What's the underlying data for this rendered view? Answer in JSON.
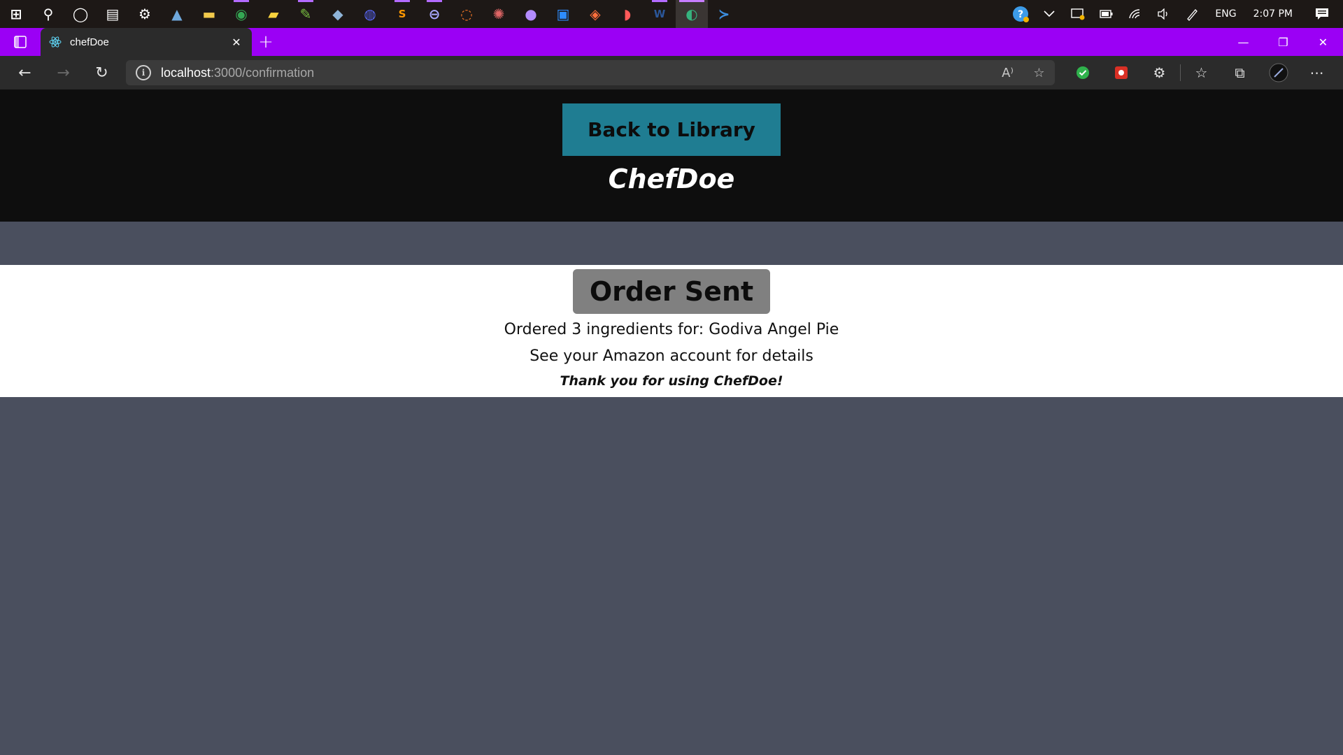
{
  "taskbar": {
    "icons": [
      {
        "name": "windows-start-icon",
        "glyph": "⊞",
        "color": "#ffffff"
      },
      {
        "name": "search-icon",
        "glyph": "⚲",
        "color": "#ffffff"
      },
      {
        "name": "cortana-icon",
        "glyph": "◯",
        "color": "#ffffff"
      },
      {
        "name": "task-view-icon",
        "glyph": "▤",
        "color": "#ffffff"
      },
      {
        "name": "settings-icon",
        "glyph": "⚙",
        "color": "#ffffff"
      },
      {
        "name": "photos-icon",
        "glyph": "▲",
        "color": "#6fa8dc"
      },
      {
        "name": "file-explorer-icon",
        "glyph": "▬",
        "color": "#f2c94c"
      },
      {
        "name": "chrome-icon",
        "glyph": "◉",
        "color": "#34a853"
      },
      {
        "name": "sticky-notes-icon",
        "glyph": "▰",
        "color": "#f7d23e"
      },
      {
        "name": "notepad-icon",
        "glyph": "✎",
        "color": "#7ac142"
      },
      {
        "name": "app-icon",
        "glyph": "◆",
        "color": "#8fb4d8"
      },
      {
        "name": "discord-icon",
        "glyph": "◍",
        "color": "#5865f2"
      },
      {
        "name": "sublime-text-icon",
        "glyph": "S",
        "color": "#ff9800"
      },
      {
        "name": "app-icon-2",
        "glyph": "⊖",
        "color": "#a9a9ff"
      },
      {
        "name": "jupyter-icon",
        "glyph": "◌",
        "color": "#f37626"
      },
      {
        "name": "network-app-icon",
        "glyph": "✺",
        "color": "#e06666"
      },
      {
        "name": "github-icon",
        "glyph": "●",
        "color": "#b48cff"
      },
      {
        "name": "zoom-icon",
        "glyph": "▣",
        "color": "#2d8cff"
      },
      {
        "name": "firefox-icon",
        "glyph": "◈",
        "color": "#ff6f3c"
      },
      {
        "name": "paint-icon",
        "glyph": "◗",
        "color": "#ff5a5a"
      },
      {
        "name": "word-icon",
        "glyph": "W",
        "color": "#2b579a"
      },
      {
        "name": "edge-icon",
        "glyph": "◐",
        "color": "#36b37e"
      },
      {
        "name": "powershell-icon",
        "glyph": "≻",
        "color": "#3c8dde"
      }
    ],
    "tray": {
      "language": "ENG",
      "time": "2:07 PM"
    }
  },
  "browser": {
    "tab_title": "chefDoe",
    "url_host": "localhost",
    "url_path": ":3000/confirmation",
    "accent_color": "#9b00f5"
  },
  "app": {
    "back_button_label": "Back to Library",
    "brand": "ChefDoe",
    "order_status": "Order Sent",
    "order_line": "Ordered 3 ingredients for: Godiva Angel Pie",
    "details_line": "See your Amazon account for details",
    "thanks_line": "Thank you for using ChefDoe!",
    "colors": {
      "button": "#1f7d92",
      "header_bg": "#0e0e0e",
      "page_bg": "#4a4f5e",
      "badge": "#808080"
    }
  }
}
